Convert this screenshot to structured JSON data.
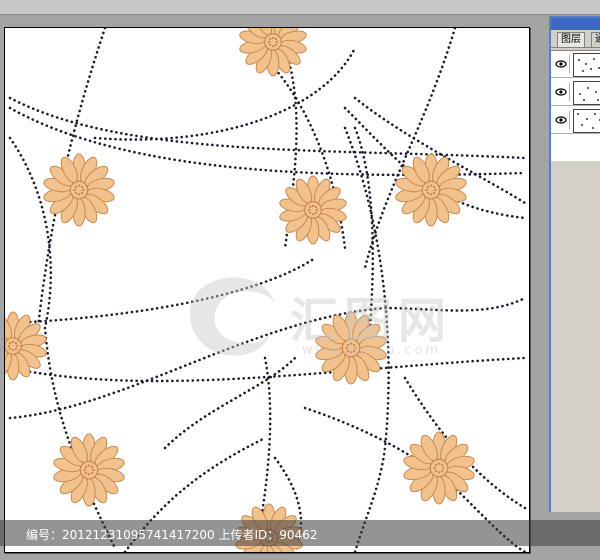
{
  "layers_panel": {
    "tabs": [
      {
        "label": "图层"
      },
      {
        "label": "通"
      }
    ],
    "layers": [
      {
        "name": ""
      },
      {
        "name": ""
      },
      {
        "name": ""
      }
    ]
  },
  "watermark": {
    "brand_text": "汇图网",
    "site_text": "www.huitu.com"
  },
  "footer": {
    "text": "编号：20121231095741417200 上传者ID：90462"
  },
  "colors": {
    "flower_fill": "#f2c28e",
    "flower_stroke": "#c98a4f",
    "dot_color": "#1a1a2e",
    "workspace": "#a4a4a4"
  }
}
